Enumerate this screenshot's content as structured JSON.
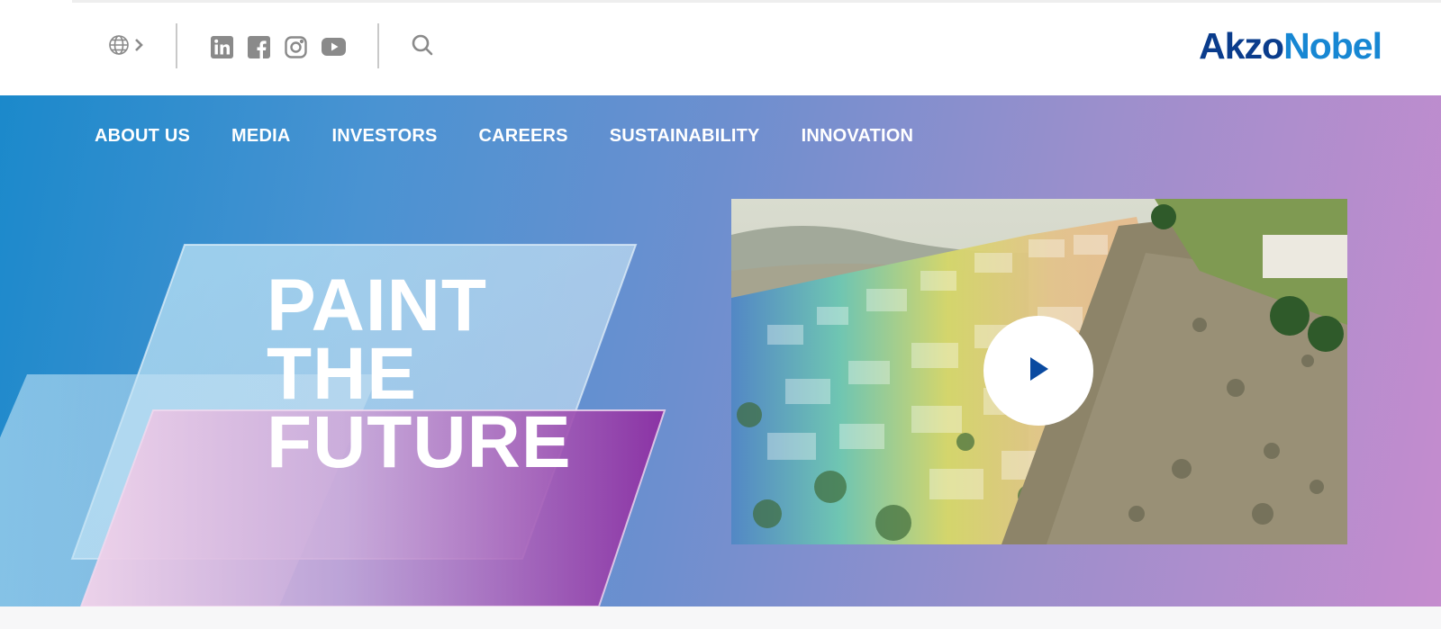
{
  "header": {
    "logo": {
      "part1": "Akzo",
      "part2": "Nobel"
    },
    "language_icon": "globe-icon",
    "social_icons": [
      "linkedin-icon",
      "facebook-icon",
      "instagram-icon",
      "youtube-icon"
    ],
    "search_icon": "search-icon"
  },
  "nav": {
    "items": [
      {
        "label": "ABOUT US"
      },
      {
        "label": "MEDIA"
      },
      {
        "label": "INVESTORS"
      },
      {
        "label": "CAREERS"
      },
      {
        "label": "SUSTAINABILITY"
      },
      {
        "label": "INNOVATION"
      }
    ]
  },
  "hero": {
    "headline": {
      "line1": "PAINT",
      "line2": "THE",
      "line3": "FUTURE"
    },
    "video": {
      "play_icon": "play-icon"
    }
  },
  "colors": {
    "brand_dark": "#0a3c8c",
    "brand_light": "#1787d3",
    "gradient_start": "#1b89cb",
    "gradient_end": "#c58cce",
    "magenta": "#9c3ca8"
  }
}
